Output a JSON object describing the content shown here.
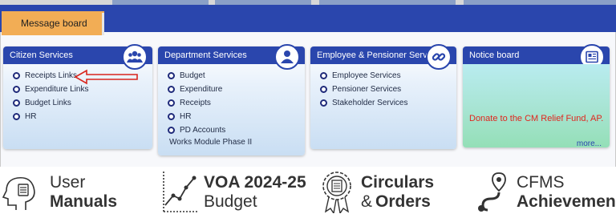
{
  "message_board": {
    "label": "Message board"
  },
  "cards": {
    "citizen": {
      "title": "Citizen Services",
      "icon": "users-icon",
      "items": [
        "Receipts Links",
        "Expenditure Links",
        "Budget Links",
        "HR"
      ]
    },
    "department": {
      "title": "Department Services",
      "icon": "user-icon",
      "items": [
        "Budget",
        "Expenditure",
        "Receipts",
        "HR",
        "PD Accounts"
      ],
      "extra": "Works Module Phase II"
    },
    "employee": {
      "title": "Employee & Pensioner Services",
      "icon": "link-icon",
      "items": [
        "Employee Services",
        "Pensioner Services",
        "Stakeholder Services"
      ]
    },
    "notice": {
      "title": "Notice board",
      "icon": "newspaper-icon",
      "text": "Donate to the CM Relief Fund, AP.",
      "more": "more..."
    }
  },
  "features": {
    "user_manuals": {
      "line1": "User",
      "line2": "Manuals"
    },
    "voa": {
      "line1": "VOA 2024-25",
      "line2": "Budget"
    },
    "circulars": {
      "line1": "Circulars",
      "amp": "&",
      "line2": "Orders"
    },
    "cfms": {
      "line1": "CFMS",
      "line2": "Achievements"
    }
  },
  "colors": {
    "header_blue": "#2a46ad",
    "tab_orange": "#f2ad55",
    "notice_red": "#e0261e",
    "arrow_red": "#d9251c"
  }
}
